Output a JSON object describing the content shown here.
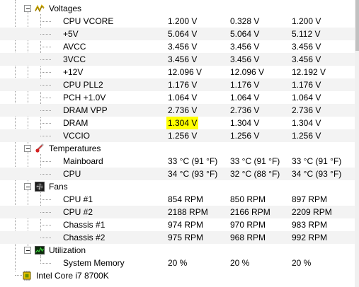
{
  "groups": {
    "voltages": {
      "label": "Voltages",
      "rows": [
        {
          "name": "CPU VCORE",
          "v1": "1.200 V",
          "v2": "0.328 V",
          "v3": "1.200 V"
        },
        {
          "name": "+5V",
          "v1": "5.064 V",
          "v2": "5.064 V",
          "v3": "5.112 V"
        },
        {
          "name": "AVCC",
          "v1": "3.456 V",
          "v2": "3.456 V",
          "v3": "3.456 V"
        },
        {
          "name": "3VCC",
          "v1": "3.456 V",
          "v2": "3.456 V",
          "v3": "3.456 V"
        },
        {
          "name": "+12V",
          "v1": "12.096 V",
          "v2": "12.096 V",
          "v3": "12.192 V"
        },
        {
          "name": "CPU PLL2",
          "v1": "1.176 V",
          "v2": "1.176 V",
          "v3": "1.176 V"
        },
        {
          "name": "PCH +1.0V",
          "v1": "1.064 V",
          "v2": "1.064 V",
          "v3": "1.064 V"
        },
        {
          "name": "DRAM VPP",
          "v1": "2.736 V",
          "v2": "2.736 V",
          "v3": "2.736 V"
        },
        {
          "name": "DRAM",
          "v1": "1.304 V",
          "v2": "1.304 V",
          "v3": "1.304 V"
        },
        {
          "name": "VCCIO",
          "v1": "1.256 V",
          "v2": "1.256 V",
          "v3": "1.256 V"
        }
      ]
    },
    "temperatures": {
      "label": "Temperatures",
      "rows": [
        {
          "name": "Mainboard",
          "v1": "33 °C  (91 °F)",
          "v2": "33 °C  (91 °F)",
          "v3": "33 °C  (91 °F)"
        },
        {
          "name": "CPU",
          "v1": "34 °C  (93 °F)",
          "v2": "32 °C  (88 °F)",
          "v3": "34 °C  (93 °F)"
        }
      ]
    },
    "fans": {
      "label": "Fans",
      "rows": [
        {
          "name": "CPU #1",
          "v1": "854 RPM",
          "v2": "850 RPM",
          "v3": "897 RPM"
        },
        {
          "name": "CPU #2",
          "v1": "2188 RPM",
          "v2": "2166 RPM",
          "v3": "2209 RPM"
        },
        {
          "name": "Chassis #1",
          "v1": "974 RPM",
          "v2": "970 RPM",
          "v3": "983 RPM"
        },
        {
          "name": "Chassis #2",
          "v1": "975 RPM",
          "v2": "968 RPM",
          "v3": "992 RPM"
        }
      ]
    },
    "utilization": {
      "label": "Utilization",
      "rows": [
        {
          "name": "System Memory",
          "v1": "20 %",
          "v2": "20 %",
          "v3": "20 %"
        }
      ]
    }
  },
  "cpu_node": {
    "label": "Intel Core i7 8700K"
  },
  "highlight_color": "#ffff00",
  "icons": {
    "voltages": "voltage-icon",
    "temperatures": "thermometer-icon",
    "fans": "fan-icon",
    "utilization": "utilization-icon",
    "cpu": "cpu-chip-icon"
  }
}
